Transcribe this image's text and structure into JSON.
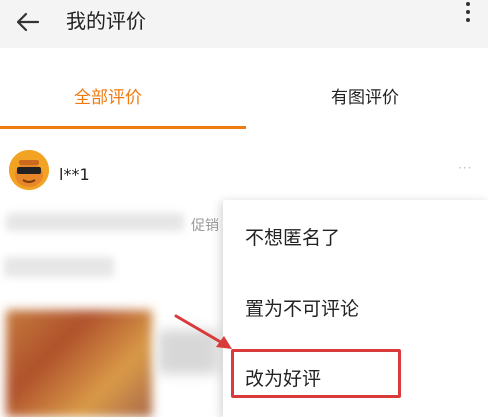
{
  "header": {
    "title": "我的评价",
    "back_icon": "arrow-left-icon",
    "more_icon": "more-vertical-icon"
  },
  "tabs": [
    {
      "label": "全部评价",
      "active": true
    },
    {
      "label": "有图评价",
      "active": false
    }
  ],
  "review": {
    "username": "l**1",
    "more": "···",
    "promo_label": "促销"
  },
  "popup_menu": {
    "items": [
      {
        "label": "不想匿名了"
      },
      {
        "label": "置为不可评论"
      },
      {
        "label": "改为好评"
      }
    ]
  },
  "colors": {
    "accent": "#f07a10",
    "highlight": "#d93a3a"
  }
}
